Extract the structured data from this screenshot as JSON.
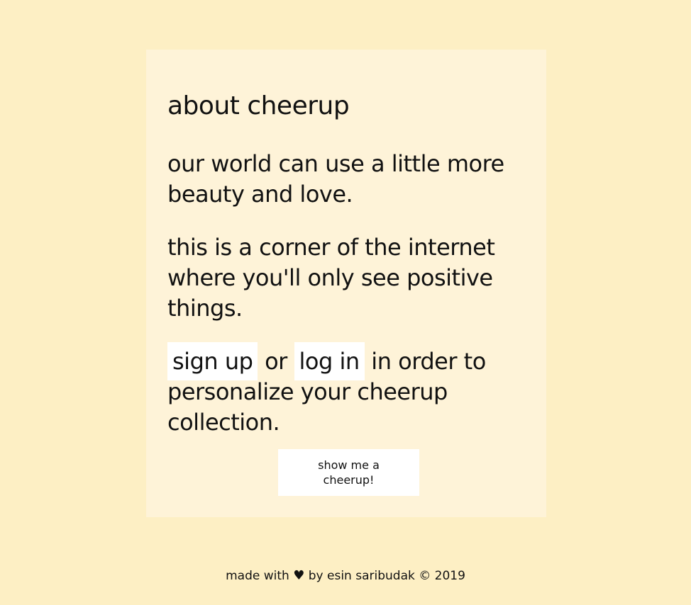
{
  "card": {
    "title": "about cheerup",
    "paragraph_1": "our world can use a little more beauty and love.",
    "paragraph_2": "this is a corner of the internet where you'll only see positive things.",
    "paragraph_3": {
      "signup_label": "sign up",
      "or_text": "or",
      "login_label": "log in",
      "rest_text": "in order to personalize your cheerup collection."
    },
    "cta_label": "show me a cheerup!"
  },
  "footer": {
    "prefix": "made with",
    "heart_icon": "heart-icon",
    "heart_glyph": "♥",
    "suffix": "by esin saribudak © 2019"
  },
  "colors": {
    "page_background": "#fdefc4",
    "card_background": "#fef3d8",
    "chip_background": "#ffffff"
  }
}
